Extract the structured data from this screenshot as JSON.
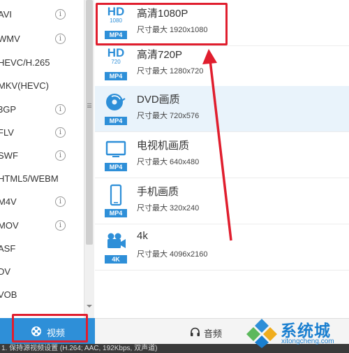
{
  "formats": [
    {
      "label": "AVI",
      "info": true
    },
    {
      "label": "WMV",
      "info": true
    },
    {
      "label": "HEVC/H.265",
      "info": false
    },
    {
      "label": "MKV(HEVC)",
      "info": false
    },
    {
      "label": "3GP",
      "info": true
    },
    {
      "label": "FLV",
      "info": true
    },
    {
      "label": "SWF",
      "info": true
    },
    {
      "label": "HTML5/WEBM",
      "info": false
    },
    {
      "label": "M4V",
      "info": true
    },
    {
      "label": "MOV",
      "info": true
    },
    {
      "label": "ASF",
      "info": false
    },
    {
      "label": "DV",
      "info": false
    },
    {
      "label": "VOB",
      "info": false
    }
  ],
  "info_glyph": "i",
  "presets": [
    {
      "title": "高清1080P",
      "sub": "尺寸最大 1920x1080",
      "icon": "hd-icon",
      "icon_main": "HD",
      "icon_sub": "1080",
      "badge": "MP4"
    },
    {
      "title": "高清720P",
      "sub": "尺寸最大 1280x720",
      "icon": "hd-icon",
      "icon_main": "HD",
      "icon_sub": "720",
      "badge": "MP4"
    },
    {
      "title": "DVD画质",
      "sub": "尺寸最大 720x576",
      "icon": "dvd-disc-icon",
      "badge": "MP4"
    },
    {
      "title": "电视机画质",
      "sub": "尺寸最大 640x480",
      "icon": "tv-icon",
      "badge": "MP4"
    },
    {
      "title": "手机画质",
      "sub": "尺寸最大 320x240",
      "icon": "phone-icon",
      "badge": "MP4"
    },
    {
      "title": "4k",
      "sub": "尺寸最大 4096x2160",
      "icon": "camera-icon",
      "badge": "4K"
    }
  ],
  "tabs": {
    "video": {
      "label": "视频",
      "icon": "film-reel-icon"
    },
    "audio": {
      "label": "音频",
      "icon": "headphones-icon"
    }
  },
  "status_text": "1. 保持源视频设置 (H.264; AAC, 192Kbps, 双声道)",
  "watermark": {
    "text": "系统城",
    "url": "xitongcheng.com"
  },
  "colors": {
    "accent": "#2e8fd8",
    "annotation": "#e01e2e",
    "selected_row": "#e9f3fb"
  }
}
